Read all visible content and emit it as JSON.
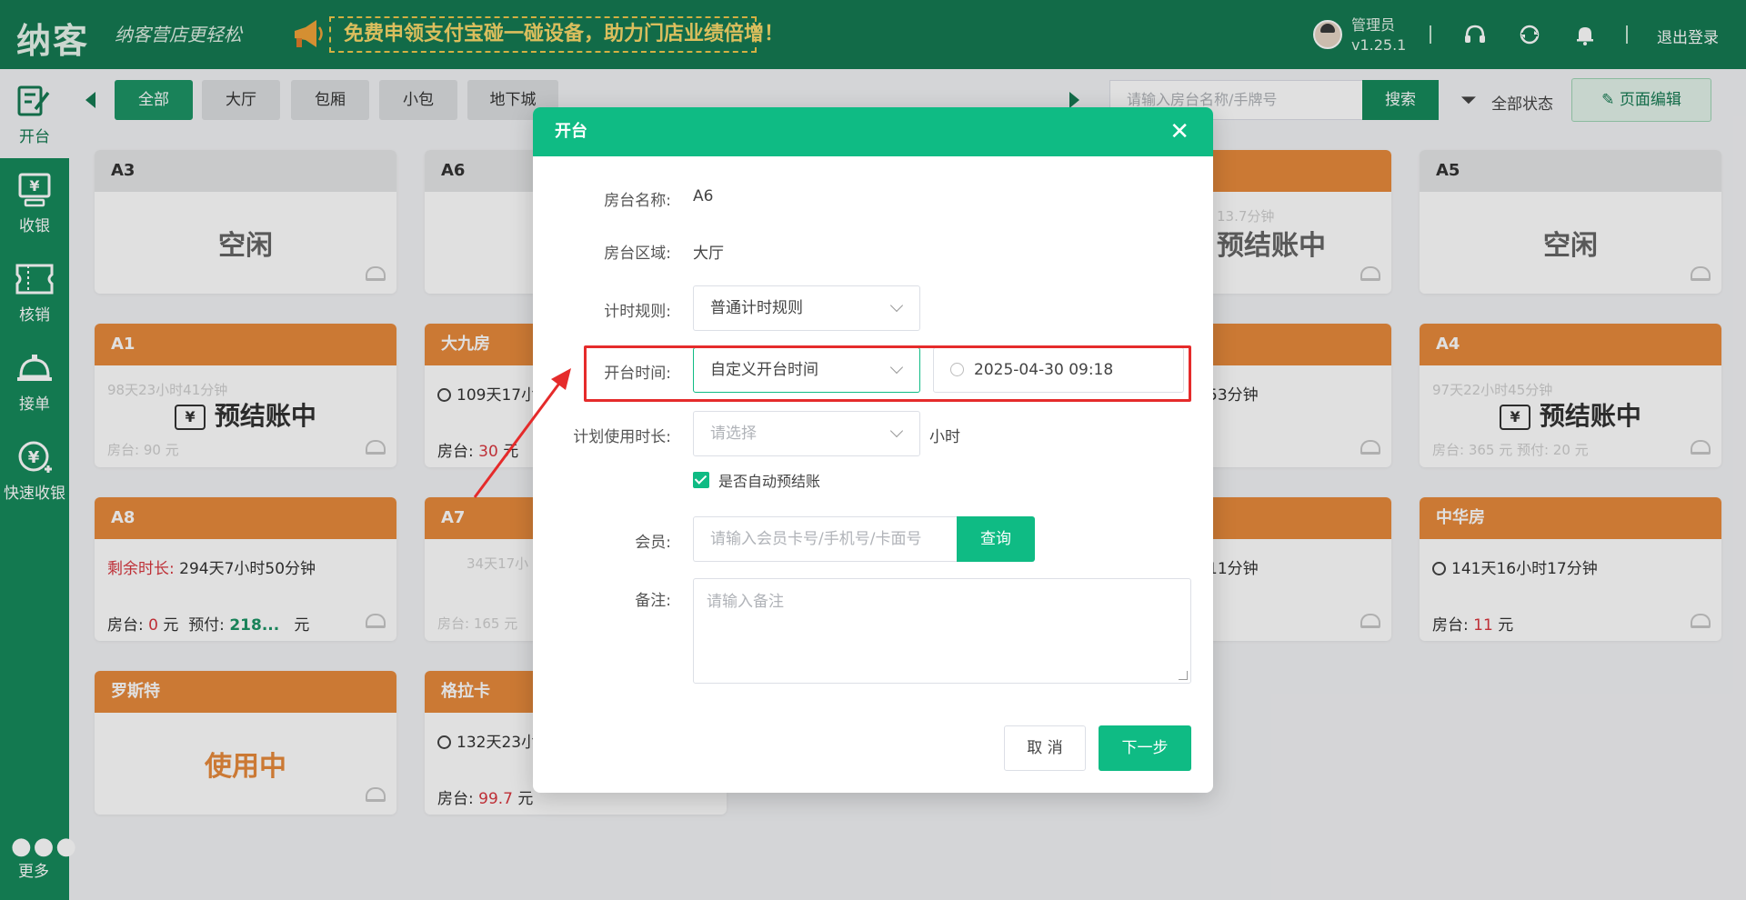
{
  "header": {
    "logo": "纳客",
    "slogan": "纳客营店更轻松",
    "promo": "免费申领支付宝碰一碰设备，助力门店业绩倍增！",
    "user_name": "管理员",
    "version": "v1.25.1",
    "logout": "退出登录",
    "icons": [
      "headset-icon",
      "refresh-icon",
      "bell-icon"
    ]
  },
  "sidebar": {
    "items": [
      {
        "label": "开台",
        "icon": "open-table-icon"
      },
      {
        "label": "收银",
        "icon": "cashier-icon"
      },
      {
        "label": "核销",
        "icon": "ticket-icon"
      },
      {
        "label": "接单",
        "icon": "service-bell-icon"
      },
      {
        "label": "快速收银",
        "icon": "quick-cashier-icon"
      }
    ],
    "more": "更多"
  },
  "tabs": [
    "全部",
    "大厅",
    "包厢",
    "小包",
    "地下城"
  ],
  "search": {
    "placeholder": "请输入房台名称/手牌号",
    "button": "搜索"
  },
  "filter_label": "全部状态",
  "edit_button": "页面编辑",
  "cards": [
    {
      "name": "A3",
      "status": "空闲"
    },
    {
      "name": "A6"
    },
    {
      "name": "",
      "faint": "13.7分钟",
      "status": "预结账中"
    },
    {
      "name": "A5",
      "status": "空闲"
    },
    {
      "name": "A1",
      "faint": "98天23小时41分钟",
      "status": "预结账中",
      "faint_bottom": "房台: 90 元"
    },
    {
      "name": "大九房",
      "line": "109天17小",
      "bottom_label": "房台:",
      "bottom_value": "30",
      "unit": "元"
    },
    {
      "name": "",
      "line": "53分钟"
    },
    {
      "name": "A4",
      "faint": "97天22小时45分钟",
      "status": "预结账中",
      "faint_bottom": "房台: 365 元  预付: 20 元"
    },
    {
      "name": "A8",
      "remain_label": "剩余时长:",
      "remain_value": "294天7小时50分钟",
      "bottom_label": "房台:",
      "bottom_value": "0",
      "unit": "元",
      "prepay_label": "预付:",
      "prepay_value": "218...",
      "prepay_unit": "元"
    },
    {
      "name": "A7",
      "faint": "34天17小",
      "faint_bottom": "房台: 165 元"
    },
    {
      "name": "",
      "line": "11分钟"
    },
    {
      "name": "中华房",
      "line": "141天16小时17分钟",
      "bottom_label": "房台:",
      "bottom_value": "11",
      "unit": "元"
    },
    {
      "name": "罗斯特",
      "status": "使用中"
    },
    {
      "name": "格拉卡",
      "line": "132天23小",
      "bottom_label": "房台:",
      "bottom_value": "99.7",
      "unit": "元"
    }
  ],
  "modal": {
    "title": "开台",
    "room_name_label": "房台名称:",
    "room_name": "A6",
    "room_area_label": "房台区域:",
    "room_area": "大厅",
    "rule_label": "计时规则:",
    "rule_value": "普通计时规则",
    "open_time_label": "开台时间:",
    "open_time_mode": "自定义开台时间",
    "open_time_value": "2025-04-30 09:18",
    "duration_label": "计划使用时长:",
    "duration_placeholder": "请选择",
    "duration_unit": "小时",
    "auto_checkout_label": "是否自动预结账",
    "auto_checkout": true,
    "member_label": "会员:",
    "member_placeholder": "请输入会员卡号/手机号/卡面号",
    "query_button": "查询",
    "note_label": "备注:",
    "note_placeholder": "请输入备注",
    "cancel_button": "取 消",
    "next_button": "下一步"
  },
  "colors": {
    "brand": "#157a52",
    "modal_header": "#0fbb84",
    "card_orange": "#e88a3c",
    "annotation": "#e52b2b"
  }
}
